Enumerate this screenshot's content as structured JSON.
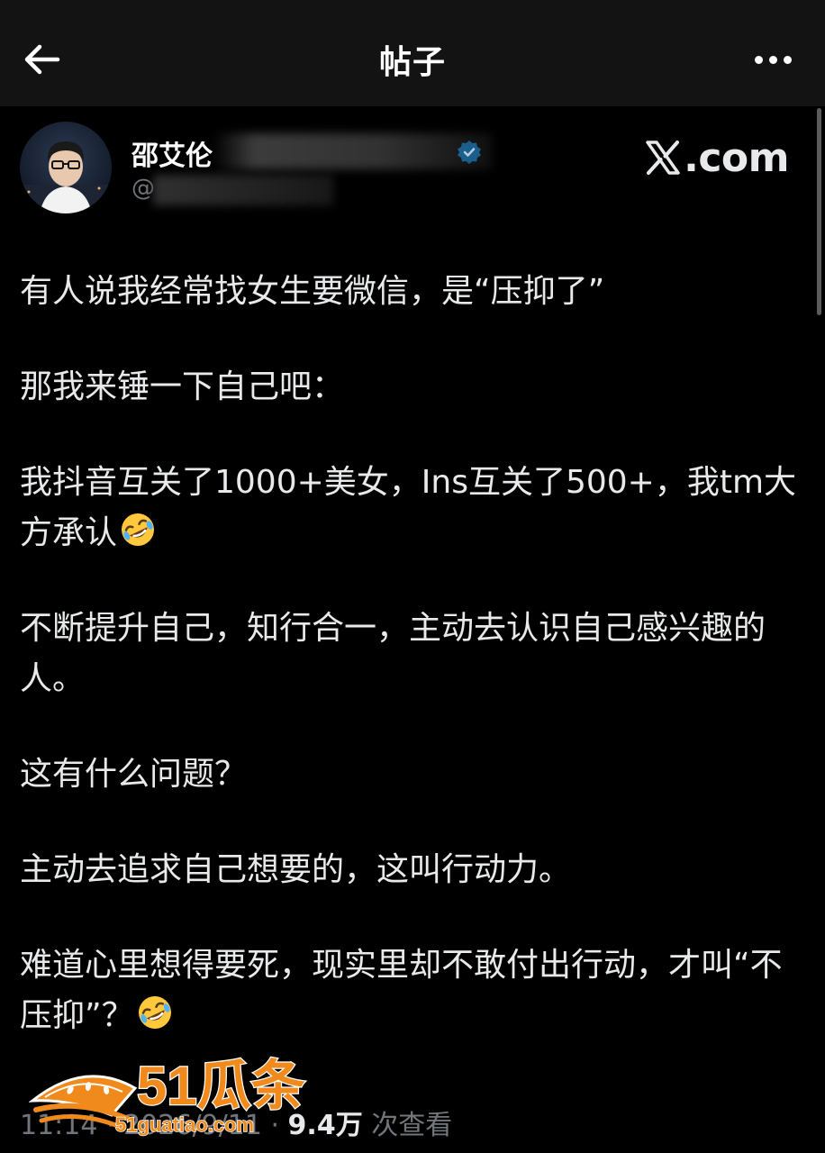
{
  "header": {
    "title": "帖子",
    "back_icon": "arrow-left-icon",
    "more_icon": "more-horizontal-icon"
  },
  "post": {
    "author_name": "邵艾伦",
    "author_handle": "@",
    "verified_icon": "verified-badge-icon",
    "source_label": ".com",
    "paragraphs": [
      "有人说我经常找女生要微信，是“压抑了”",
      "那我来锤一下自己吧：",
      "我抖音互关了1000+美女，Ins互关了500+，我tm大方承认",
      "不断提升自己，知行合一，主动去认识自己感兴趣的人。",
      "这有什么问题？",
      "主动去追求自己想要的，这叫行动力。",
      "难道心里想得要死，现实里却不敢付出行动，才叫“不压抑”？"
    ],
    "emoji": "rolling-on-floor-laughing-emoji",
    "time": "11:14",
    "date": "2026/9/11",
    "views_count": "9.4万",
    "views_label": "次查看"
  },
  "watermark": {
    "brand": "51瓜条",
    "url": "51guatiao.com"
  },
  "colors": {
    "background": "#000000",
    "topbar": "#131313",
    "text": "#e7e9ea",
    "muted": "#71767b",
    "verified": "#1d9bf0",
    "watermark": "#f08a1c"
  }
}
